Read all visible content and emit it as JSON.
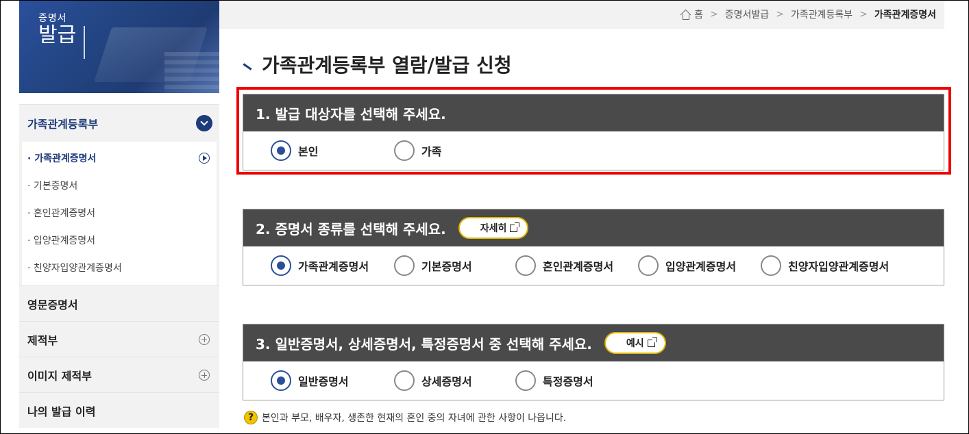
{
  "banner": {
    "title_small": "증명서",
    "title_big": "발급"
  },
  "sidebar": {
    "group": {
      "label": "가족관계등록부",
      "items": [
        {
          "label": "· 가족관계증명서",
          "active": true
        },
        {
          "label": "· 기본증명서"
        },
        {
          "label": "· 혼인관계증명서"
        },
        {
          "label": "· 입양관계증명서"
        },
        {
          "label": "· 친양자입양관계증명서"
        }
      ]
    },
    "items": [
      {
        "label": "영문증명서"
      },
      {
        "label": "제적부"
      },
      {
        "label": "이미지 제적부"
      },
      {
        "label": "나의 발급 이력"
      }
    ]
  },
  "breadcrumb": {
    "items": [
      "홈",
      "증명서발급",
      "가족관계등록부"
    ],
    "current": "가족관계증명서"
  },
  "page": {
    "title": "가족관계등록부 열람/발급 신청"
  },
  "sections": [
    {
      "title": "1. 발급 대상자를 선택해 주세요.",
      "options": [
        {
          "label": "본인",
          "checked": true
        },
        {
          "label": "가족",
          "checked": false
        }
      ]
    },
    {
      "title": "2. 증명서 종류를 선택해 주세요.",
      "button": "자세히",
      "options": [
        {
          "label": "가족관계증명서",
          "checked": true
        },
        {
          "label": "기본증명서",
          "checked": false
        },
        {
          "label": "혼인관계증명서",
          "checked": false
        },
        {
          "label": "입양관계증명서",
          "checked": false
        },
        {
          "label": "친양자입양관계증명서",
          "checked": false
        }
      ]
    },
    {
      "title": "3. 일반증명서, 상세증명서, 특정증명서 중 선택해 주세요.",
      "button": "예시",
      "options": [
        {
          "label": "일반증명서",
          "checked": true
        },
        {
          "label": "상세증명서",
          "checked": false
        },
        {
          "label": "특정증명서",
          "checked": false
        }
      ]
    }
  ],
  "note": {
    "text": "본인과 부모, 배우자, 생존한 현재의 혼인 중의 자녀에 관한 사항이 나옵니다."
  },
  "colors": {
    "navy": "#1d3b7a",
    "header_gray": "#4a4a4a",
    "highlight_red": "#ee0000",
    "pill_border": "#e0b400"
  }
}
